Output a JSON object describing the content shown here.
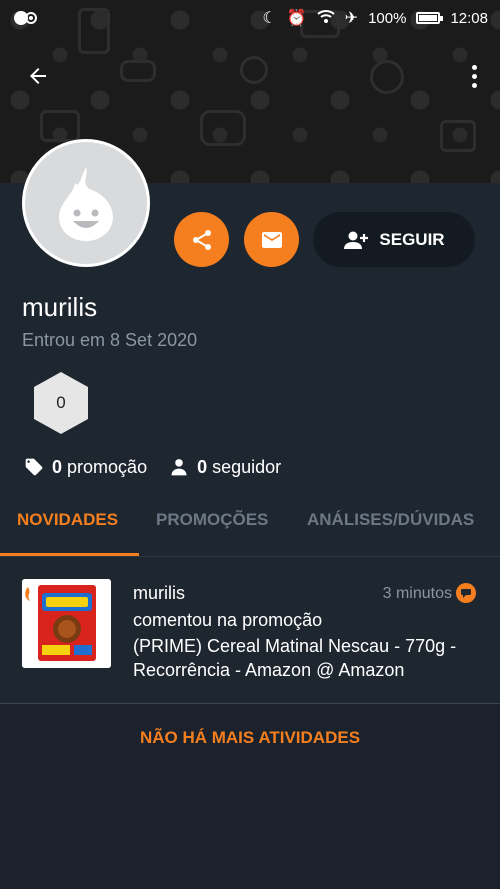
{
  "status_bar": {
    "battery": "100%",
    "time": "12:08",
    "icons": [
      "app-notification-icon",
      "moon-icon",
      "alarm-icon",
      "wifi-icon",
      "airplane-icon",
      "battery-icon"
    ]
  },
  "profile": {
    "username": "murilis",
    "joined": "Entrou em 8 Set 2020",
    "level": "0",
    "follow_label": "SEGUIR",
    "stats": {
      "promotions_count": "0",
      "promotions_label": "promoção",
      "followers_count": "0",
      "followers_label": "seguidor"
    }
  },
  "tabs": [
    {
      "label": "NOVIDADES",
      "active": true
    },
    {
      "label": "PROMOÇÕES",
      "active": false
    },
    {
      "label": "ANÁLISES/DÚVIDAS",
      "active": false
    }
  ],
  "feed": [
    {
      "user": "murilis",
      "time": "3 minutos",
      "action": "comentou na promoção",
      "title": "(PRIME) Cereal Matinal Nescau - 770g - Recorrência - Amazon @ Amazon"
    }
  ],
  "empty_message": "NÃO HÁ MAIS ATIVIDADES",
  "colors": {
    "accent": "#f57f1f",
    "background": "#1e2630",
    "muted_text": "#8a96a3"
  }
}
